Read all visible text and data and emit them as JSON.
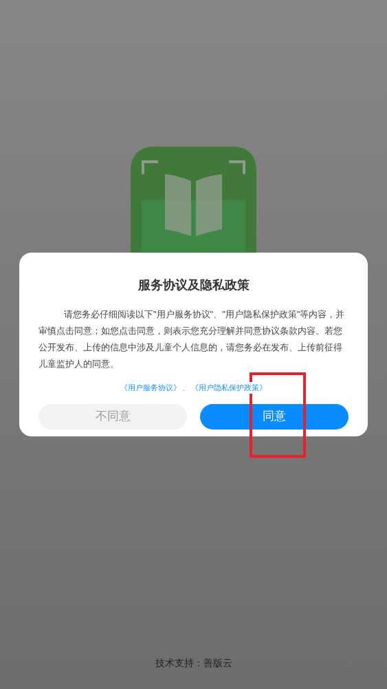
{
  "dialog": {
    "title": "服务协议及隐私政策",
    "message": "请您务必仔细阅读以下\"用户服务协议\"、\"用户隐私保护政策\"等内容，并审慎点击同意；如您点击同意，则表示您充分理解并同意协议条款内容。若您公开发布、上传的信息中涉及儿童个人信息的，请您务必在发布、上传前征得儿童监护人的同意。",
    "links": [
      {
        "text": "《用户服务协议》"
      },
      {
        "text": "《用户隐私保护政策》"
      }
    ],
    "link_separator": "、",
    "buttons": [
      {
        "label": "不同意",
        "kind": "secondary",
        "highlighted": false
      },
      {
        "label": "同意",
        "kind": "primary",
        "highlighted": true
      }
    ]
  },
  "footer": "技术支持：善版云"
}
